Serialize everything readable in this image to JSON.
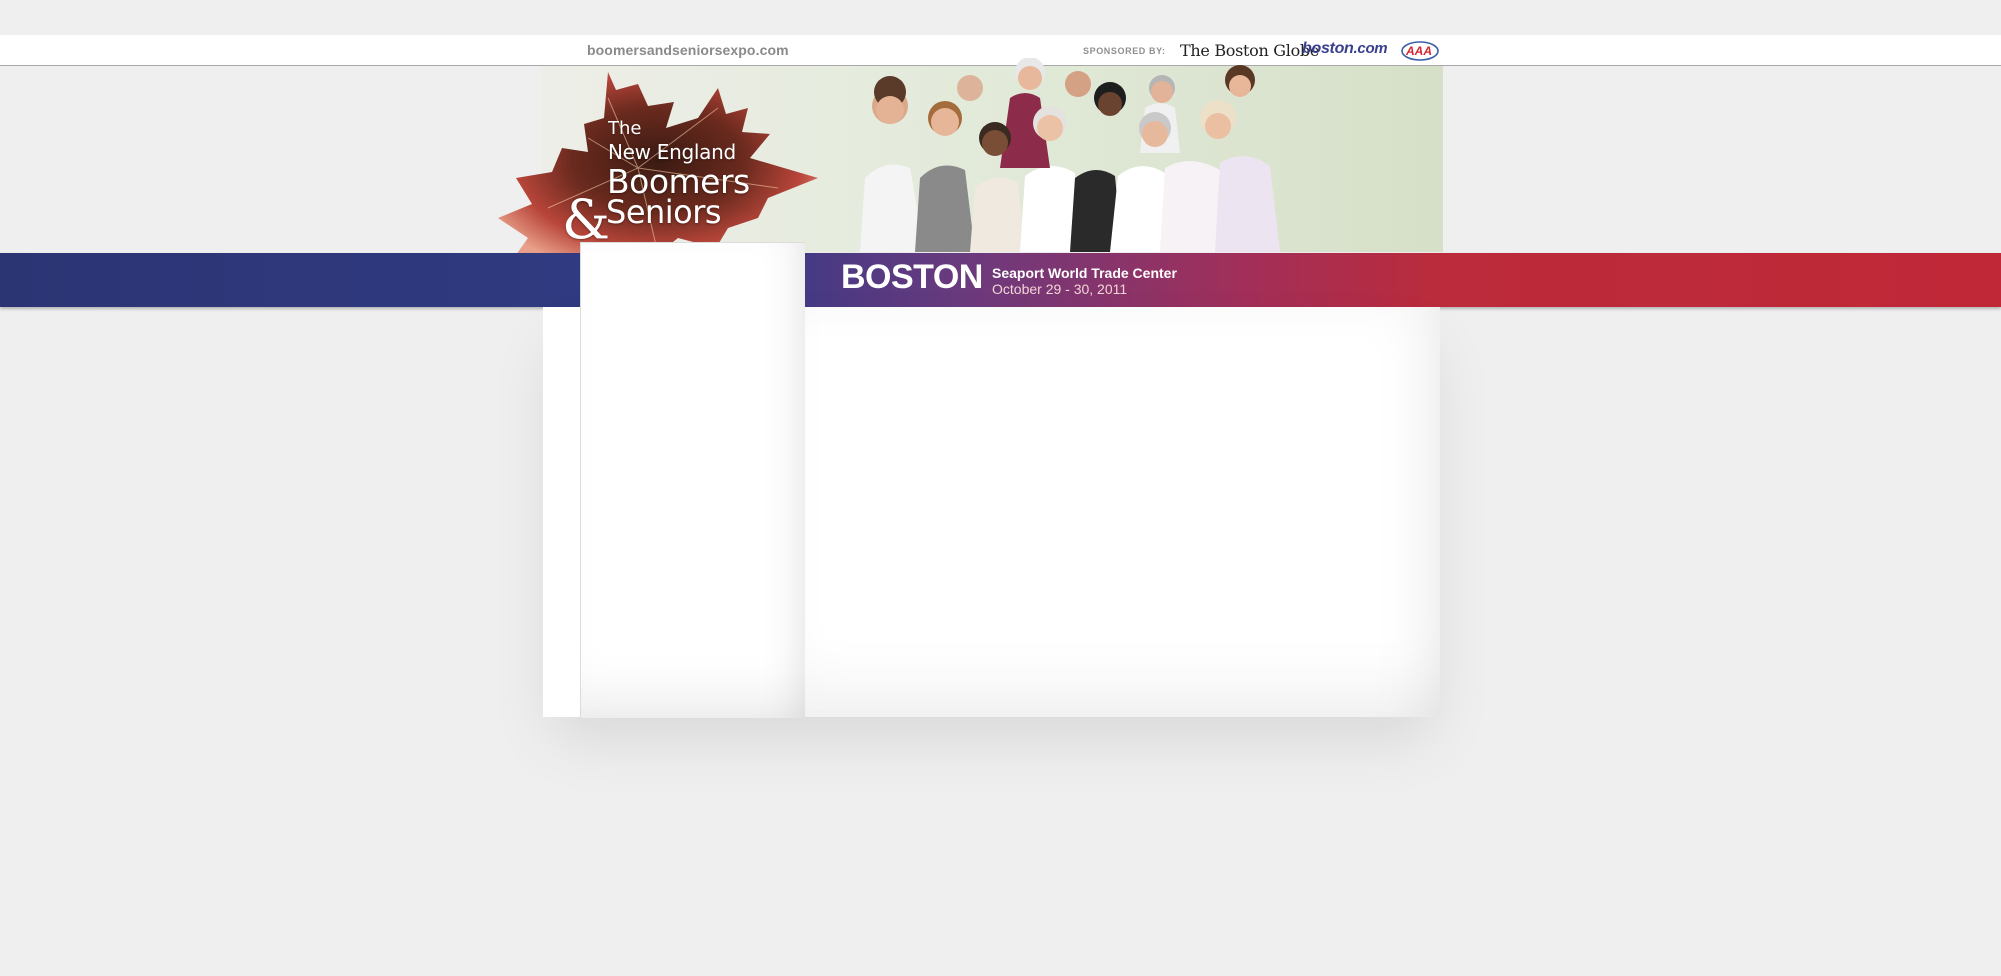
{
  "topbar": {
    "site_url": "boomersandseniorsexpo.com",
    "sponsored_by_label": "SPONSORED BY:",
    "sponsors": {
      "globe": "The Boston Globe",
      "bostoncom_main": "boston",
      "bostoncom_suffix": ".com",
      "aaa": "AAA"
    }
  },
  "header": {
    "title_the": "The",
    "title_new_england": "New England",
    "title_boomers": "Boomers",
    "title_amp": "&",
    "title_seniors": "Seniors"
  },
  "event": {
    "city": "BOSTON",
    "venue": "Seaport World Trade Center",
    "dates": "October 29 - 30, 2011"
  },
  "colors": {
    "stripe_blue": "#2c3574",
    "stripe_red": "#c02837",
    "leaf": "#b8453a"
  }
}
